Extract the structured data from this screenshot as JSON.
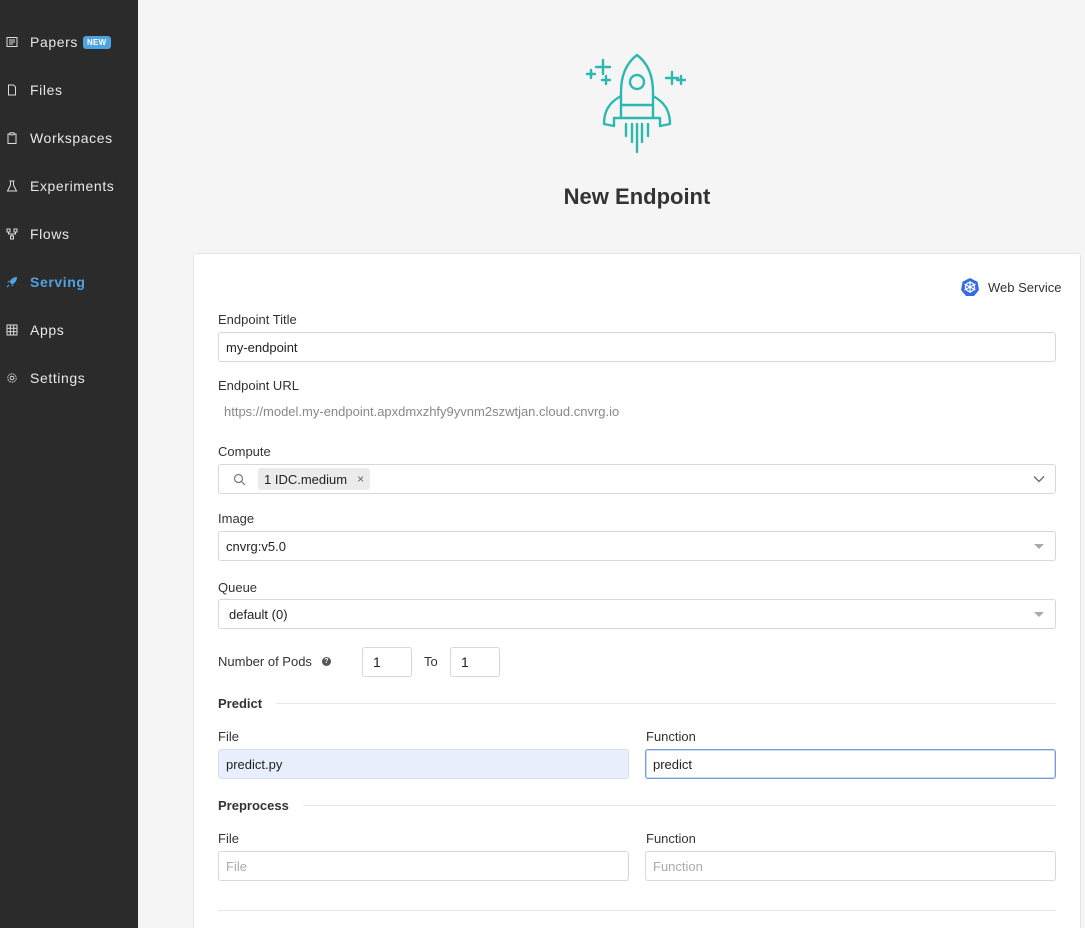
{
  "sidebar": {
    "items": [
      {
        "label": "Papers",
        "icon": "papers-icon",
        "badge": "NEW"
      },
      {
        "label": "Files",
        "icon": "file-icon"
      },
      {
        "label": "Workspaces",
        "icon": "clipboard-icon"
      },
      {
        "label": "Experiments",
        "icon": "flask-icon"
      },
      {
        "label": "Flows",
        "icon": "flow-icon"
      },
      {
        "label": "Serving",
        "icon": "rocket-icon",
        "active": true
      },
      {
        "label": "Apps",
        "icon": "grid-icon"
      },
      {
        "label": "Settings",
        "icon": "gear-icon"
      }
    ]
  },
  "header": {
    "title": "New Endpoint",
    "icon": "rocket-illustration-icon"
  },
  "colors": {
    "sidebar_bg": "#2b2b2b",
    "active": "#4fa3e0",
    "teal": "#2bb8b0",
    "k8s_blue": "#326ce5"
  },
  "form": {
    "service_type": "Web Service",
    "service_icon": "kubernetes-icon",
    "endpoint_title_label": "Endpoint Title",
    "endpoint_title_value": "my-endpoint",
    "endpoint_url_label": "Endpoint URL",
    "endpoint_url_value": "https://model.my-endpoint.apxdmxzhfy9yvnm2szwtjan.cloud.cnvrg.io",
    "compute_label": "Compute",
    "compute_chip": "1 IDC.medium",
    "compute_chip_remove": "×",
    "image_label": "Image",
    "image_value": "cnvrg:v5.0",
    "queue_label": "Queue",
    "queue_value": "default (0)",
    "pods_label": "Number of Pods",
    "pods_help": "?",
    "pods_min": "1",
    "pods_to": "To",
    "pods_max": "1",
    "predict": {
      "section": "Predict",
      "file_label": "File",
      "file_value": "predict.py",
      "function_label": "Function",
      "function_value": "predict"
    },
    "preprocess": {
      "section": "Preprocess",
      "file_label": "File",
      "file_placeholder": "File",
      "function_label": "Function",
      "function_placeholder": "Function"
    }
  }
}
